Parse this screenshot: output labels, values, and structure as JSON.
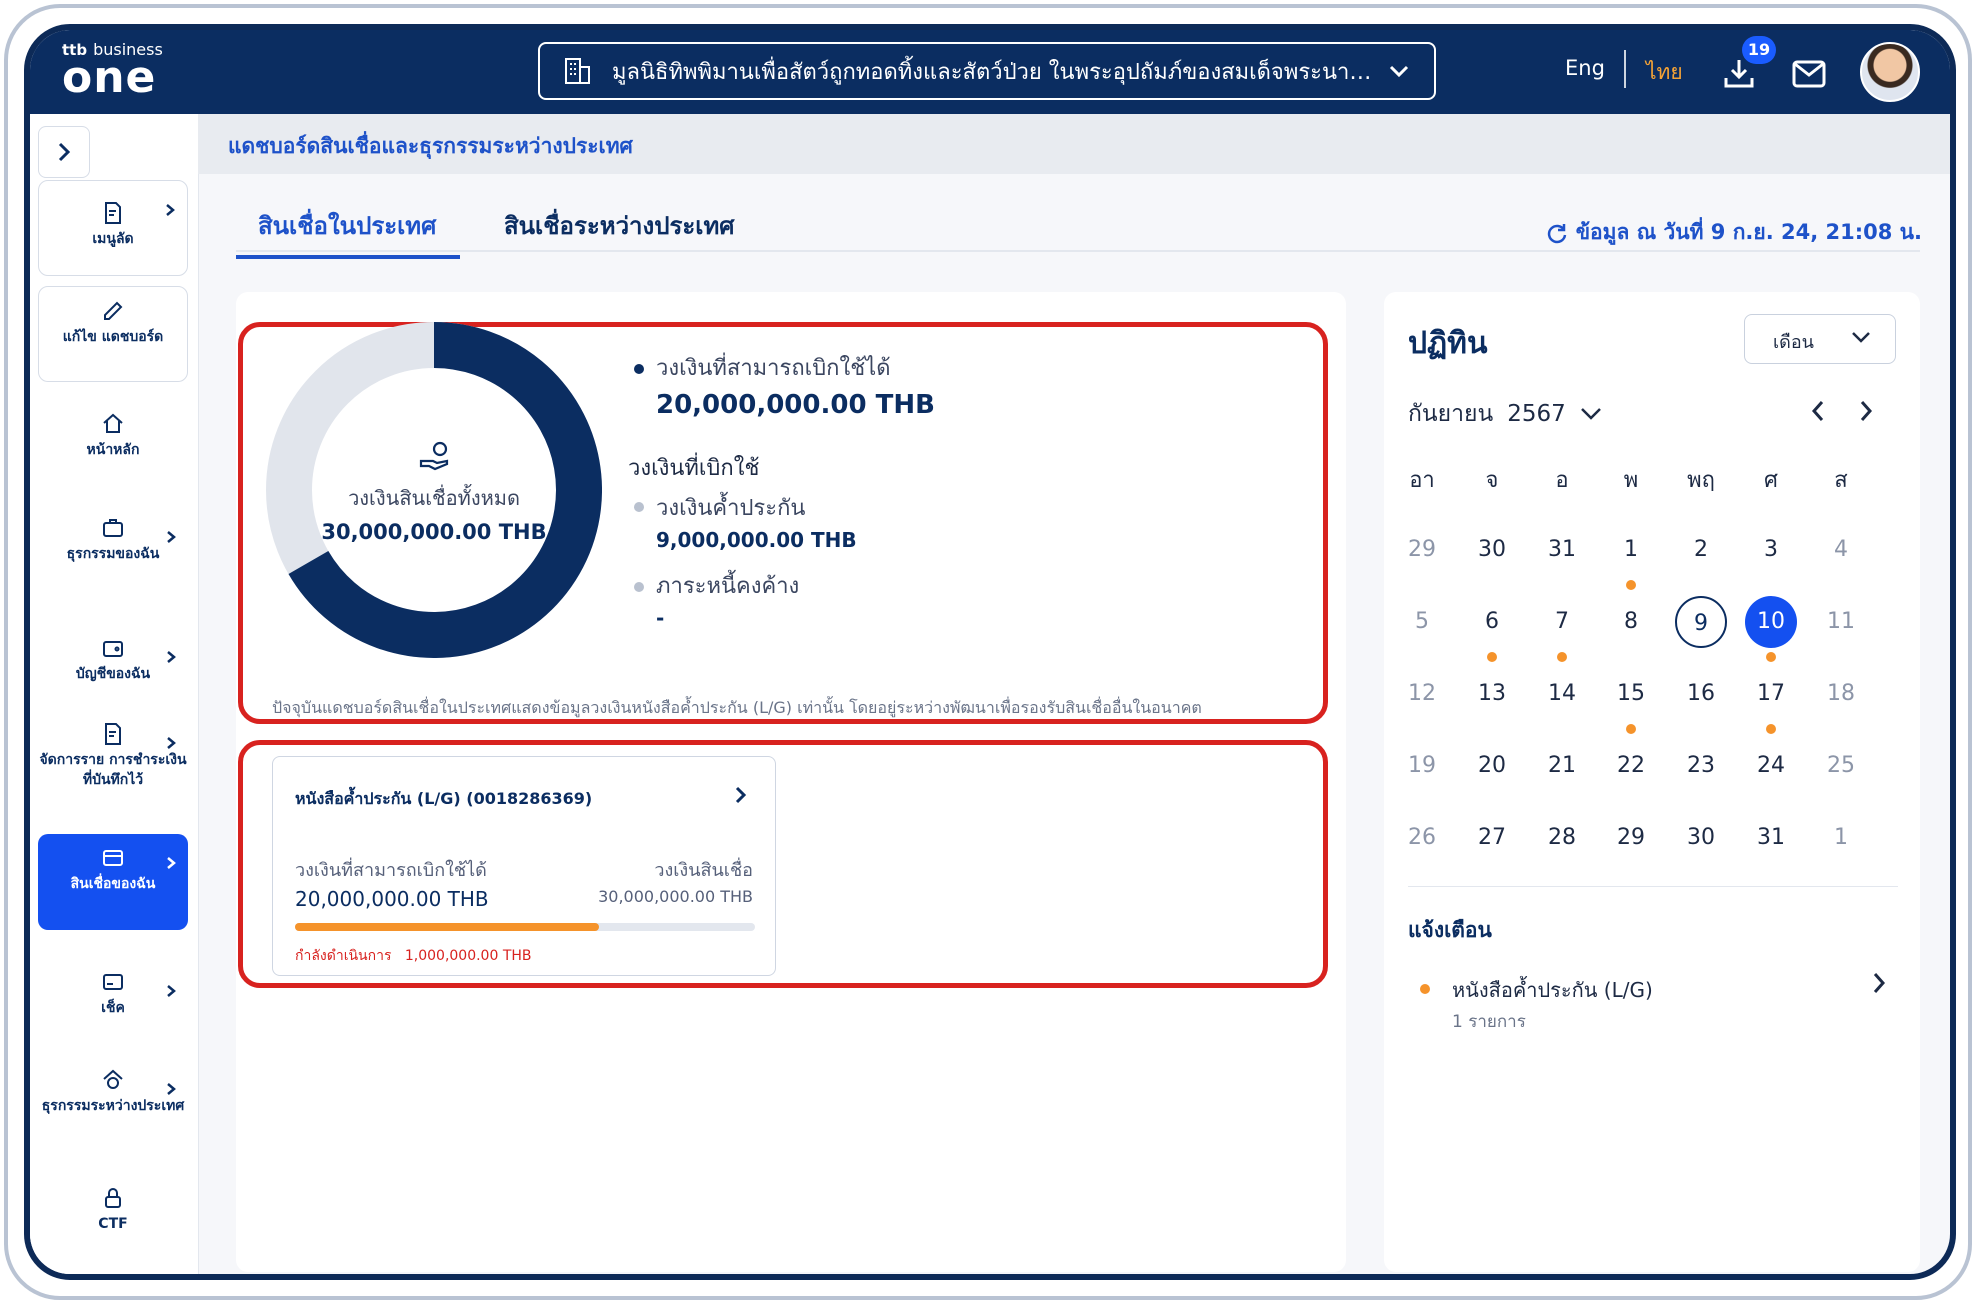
{
  "header": {
    "logo_small": "ttb",
    "logo_business": "business",
    "logo_main": "one",
    "company_name": "มูลนิธิทิพพิมานเพื่อสัตว์ถูกทอดทิ้งและสัตว์ป่วย ในพระอุปถัมภ์ของสมเด็จพระนางเจ้า...",
    "lang_en": "Eng",
    "lang_th": "ไทย",
    "download_badge": "19"
  },
  "sidebar": {
    "items": [
      {
        "label": "เมนูลัด"
      },
      {
        "label": "แก้ไข แดชบอร์ด"
      },
      {
        "label": "หน้าหลัก"
      },
      {
        "label": "ธุรกรรมของฉัน"
      },
      {
        "label": "บัญชีของฉัน"
      },
      {
        "label": "จัดการราย การชำระเงินที่บันทึกไว้"
      },
      {
        "label": "สินเชื่อของฉัน"
      },
      {
        "label": "เช็ค"
      },
      {
        "label": "ธุรกรรมระหว่างประเทศ"
      },
      {
        "label": "CTF"
      }
    ]
  },
  "breadcrumb": "แดชบอร์ดสินเชื่อและธุรกรรมระหว่างประเทศ",
  "tabs": [
    {
      "label": "สินเชื่อในประเทศ",
      "active": true
    },
    {
      "label": "สินเชื่อระหว่างประเทศ",
      "active": false
    }
  ],
  "updated": "ข้อมูล ณ วันที่ 9 ก.ย. 24, 21:08 น.",
  "summary": {
    "total_label": "วงเงินสินเชื่อทั้งหมด",
    "total_value": "30,000,000.00 THB",
    "available_label": "วงเงินที่สามารถเบิกใช้ได้",
    "available_value": "20,000,000.00 THB",
    "used_heading": "วงเงินที่เบิกใช้",
    "guarantee_label": "วงเงินค้ำประกัน",
    "guarantee_value": "9,000,000.00 THB",
    "outstanding_label": "ภาระหนี้คงค้าง",
    "outstanding_value": "-",
    "note": "ปัจจุบันแดชบอร์ดสินเชื่อในประเทศแสดงข้อมูลวงเงินหนังสือค้ำประกัน (L/G) เท่านั้น โดยอยู่ระหว่างพัฒนาเพื่อรองรับสินเชื่ออื่นในอนาคต",
    "available_fraction": 0.6667,
    "colors": {
      "used": "#e1e5ec",
      "available": "#0b2d61"
    }
  },
  "lg_card": {
    "title": "หนังสือค้ำประกัน (L/G) (0018286369)",
    "available_label": "วงเงินที่สามารถเบิกใช้ได้",
    "available_value": "20,000,000.00 THB",
    "credit_label": "วงเงินสินเชื่อ",
    "credit_value": "30,000,000.00 THB",
    "progress_fraction": 0.66,
    "status_label": "กำลังดำเนินการ",
    "status_value": "1,000,000.00 THB"
  },
  "calendar": {
    "title": "ปฏิทิน",
    "view": "เดือน",
    "month": "กันยายน",
    "year": "2567",
    "weekdays": [
      "อา",
      "จ",
      "อ",
      "พ",
      "พฤ",
      "ศ",
      "ส"
    ],
    "weeks": [
      [
        {
          "d": "29",
          "m": true
        },
        {
          "d": "30"
        },
        {
          "d": "31"
        },
        {
          "d": "1",
          "dot": true
        },
        {
          "d": "2"
        },
        {
          "d": "3"
        },
        {
          "d": "4",
          "m": true
        }
      ],
      [
        {
          "d": "5",
          "m": true
        },
        {
          "d": "6",
          "dot": true
        },
        {
          "d": "7",
          "dot": true
        },
        {
          "d": "8"
        },
        {
          "d": "9",
          "today": true
        },
        {
          "d": "10",
          "sel": true,
          "dot": true
        },
        {
          "d": "11",
          "m": true
        }
      ],
      [
        {
          "d": "12",
          "m": true
        },
        {
          "d": "13"
        },
        {
          "d": "14"
        },
        {
          "d": "15",
          "dot": true
        },
        {
          "d": "16"
        },
        {
          "d": "17",
          "dot": true
        },
        {
          "d": "18",
          "m": true
        }
      ],
      [
        {
          "d": "19",
          "m": true
        },
        {
          "d": "20"
        },
        {
          "d": "21"
        },
        {
          "d": "22"
        },
        {
          "d": "23"
        },
        {
          "d": "24"
        },
        {
          "d": "25",
          "m": true
        }
      ],
      [
        {
          "d": "26",
          "m": true
        },
        {
          "d": "27"
        },
        {
          "d": "28"
        },
        {
          "d": "29"
        },
        {
          "d": "30"
        },
        {
          "d": "31"
        },
        {
          "d": "1",
          "m": true
        }
      ]
    ],
    "alerts_title": "แจ้งเตือน",
    "alert_label": "หนังสือค้ำประกัน (L/G)",
    "alert_count": "1 รายการ"
  }
}
